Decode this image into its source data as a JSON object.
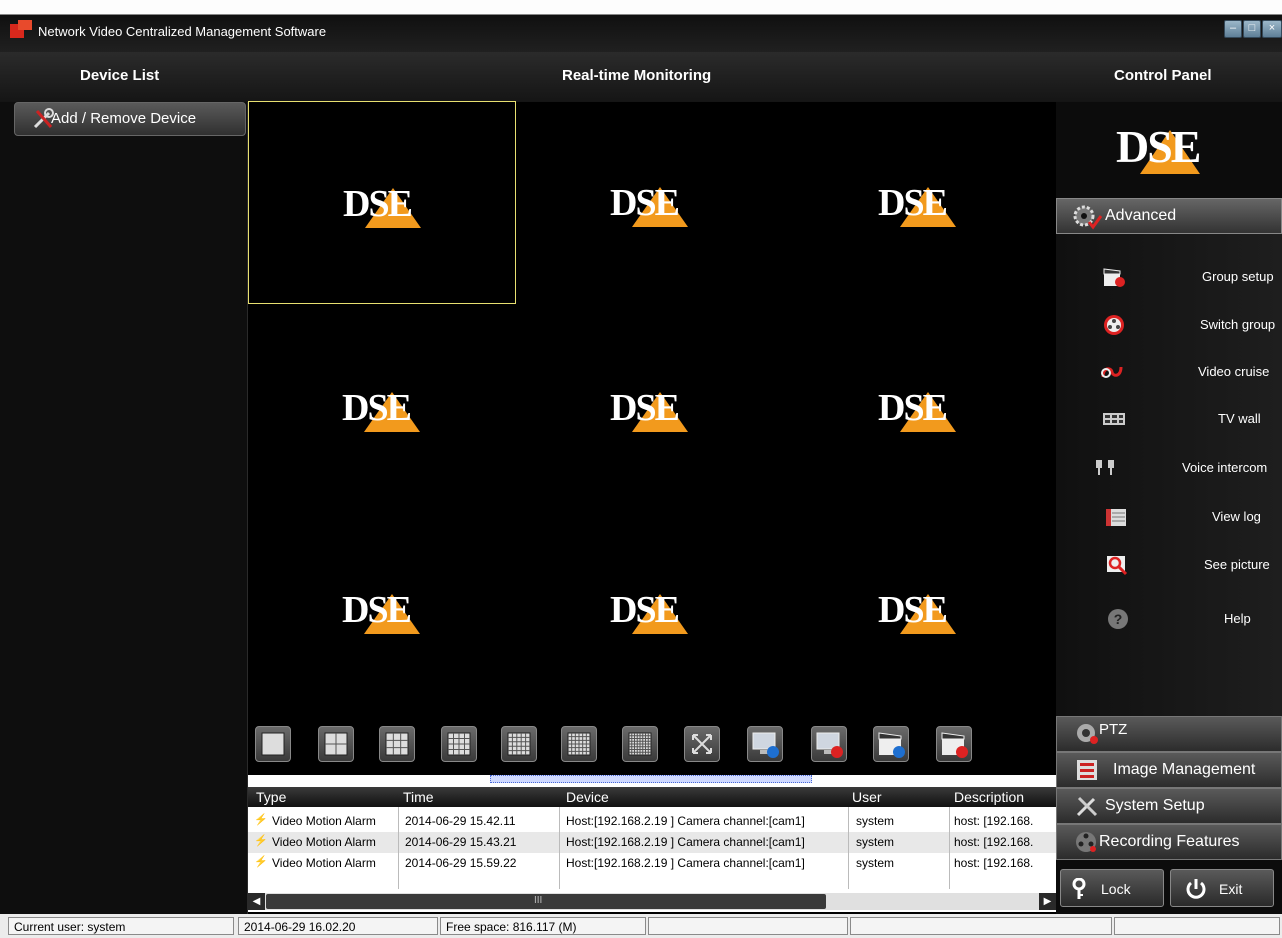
{
  "window": {
    "title": "Network Video Centralized Management Software",
    "controls": [
      "minimize-icon",
      "maximize-icon",
      "close-icon"
    ]
  },
  "header": {
    "device_list": "Device List",
    "realtime": "Real-time Monitoring",
    "control_panel": "Control Panel"
  },
  "device_list": {
    "add_remove": "Add / Remove Device"
  },
  "brand": {
    "logo_text": "DSE",
    "colors": {
      "logo_orange": "#f29a1d",
      "selection": "#e8e070"
    }
  },
  "video_grid": {
    "rows": 3,
    "cols": 3,
    "selected_tile": 0,
    "tile_logo": "DSE"
  },
  "toolbar": {
    "buttons": [
      "single-view-icon",
      "quad-view-icon",
      "nine-view-icon",
      "sixteen-view-icon",
      "twenty-five-view-icon",
      "thirty-six-view-icon",
      "sixty-four-view-icon",
      "fullscreen-icon",
      "start-monitor-icon",
      "stop-monitor-icon",
      "start-record-icon",
      "stop-record-icon"
    ]
  },
  "log": {
    "columns": [
      "Type",
      "Time",
      "Device",
      "User",
      "Description"
    ],
    "rows": [
      {
        "type": "Video Motion Alarm",
        "time": "2014-06-29 15.42.11",
        "device": "Host:[192.168.2.19 ] Camera channel:[cam1]",
        "user": "system",
        "description": "host: [192.168."
      },
      {
        "type": "Video Motion Alarm",
        "time": "2014-06-29 15.43.21",
        "device": "Host:[192.168.2.19 ] Camera channel:[cam1]",
        "user": "system",
        "description": "host: [192.168."
      },
      {
        "type": "Video Motion Alarm",
        "time": "2014-06-29 15.59.22",
        "device": "Host:[192.168.2.19 ] Camera channel:[cam1]",
        "user": "system",
        "description": "host: [192.168."
      }
    ],
    "scroll_mark": "III"
  },
  "control_panel": {
    "logo": "DSE",
    "advanced": "Advanced",
    "items": [
      {
        "label": "Group setup",
        "icon": "clapper-gear-icon"
      },
      {
        "label": "Switch group",
        "icon": "film-reel-icon"
      },
      {
        "label": "Video cruise",
        "icon": "cruise-arrows-icon"
      },
      {
        "label": "TV wall",
        "icon": "tv-wall-icon"
      },
      {
        "label": "Voice intercom",
        "icon": "microphone-icon"
      },
      {
        "label": "View log",
        "icon": "log-list-icon"
      },
      {
        "label": "See picture",
        "icon": "magnifier-picture-icon"
      },
      {
        "label": "Help",
        "icon": "help-icon"
      }
    ],
    "ptz": "PTZ",
    "image_management": "Image Management",
    "system_setup": "System Setup",
    "recording_features": "Recording Features",
    "lock": "Lock",
    "exit": "Exit"
  },
  "status": {
    "user": "Current user: system",
    "datetime": "2014-06-29 16.02.20",
    "free_space": "Free space: 816.117 (M)"
  }
}
